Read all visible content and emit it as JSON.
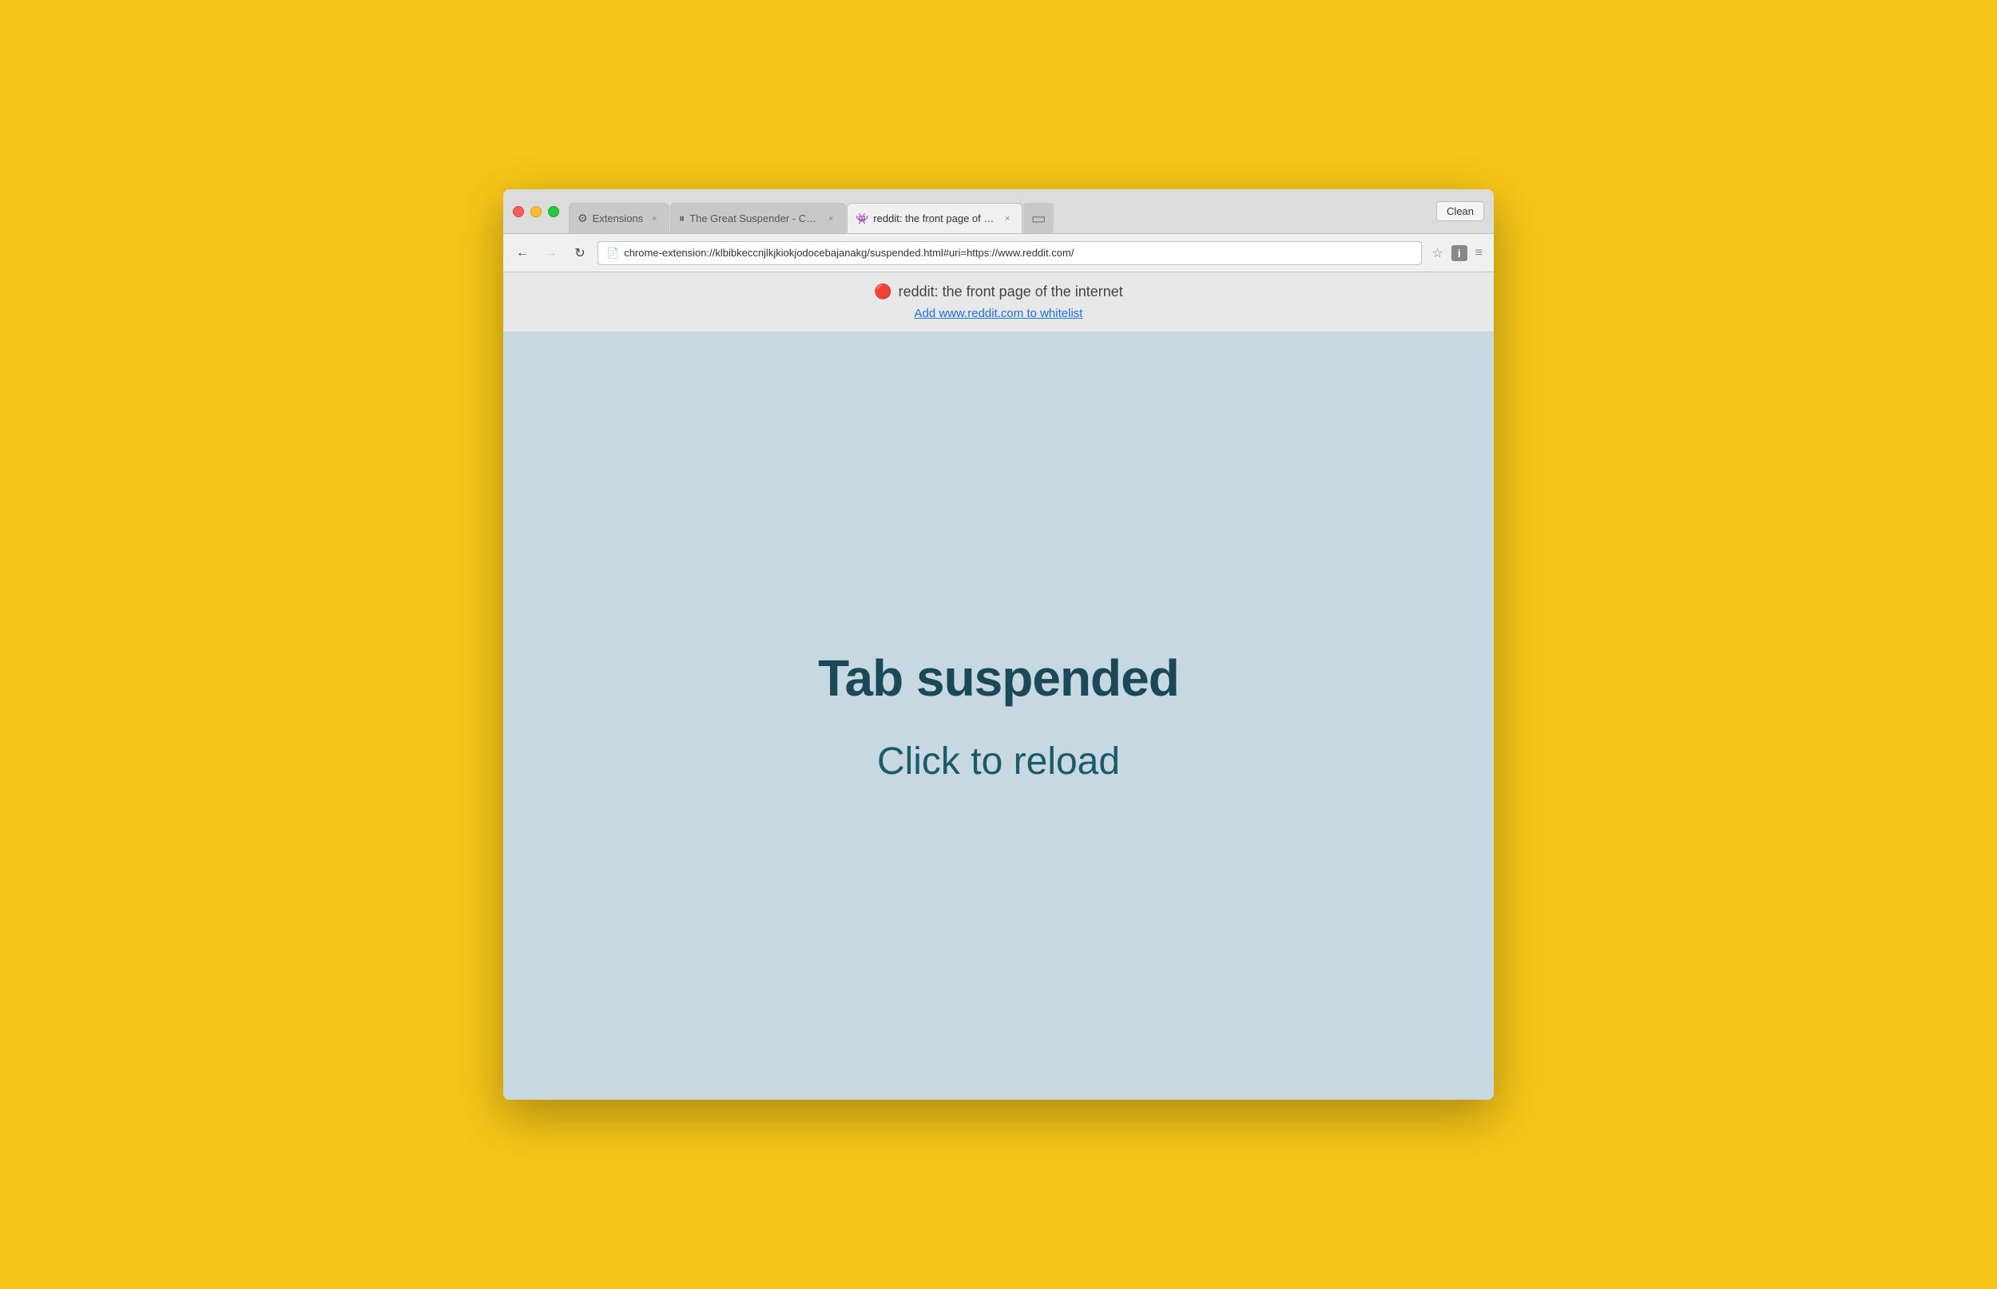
{
  "browser": {
    "background_color": "#F5C518",
    "clean_button_label": "Clean"
  },
  "tabs": [
    {
      "id": "extensions",
      "icon": "⚙",
      "label": "Extensions",
      "active": false,
      "close_label": "×"
    },
    {
      "id": "great-suspender",
      "icon": "⏸",
      "label": "The Great Suspender - Ch…",
      "active": false,
      "close_label": "×"
    },
    {
      "id": "reddit",
      "icon": "🔴",
      "label": "reddit: the front page of th…",
      "active": true,
      "close_label": "×"
    },
    {
      "id": "new-tab",
      "icon": "",
      "label": "",
      "active": false,
      "close_label": ""
    }
  ],
  "navigation": {
    "back_title": "Back",
    "forward_title": "Forward",
    "reload_title": "Reload",
    "address": "chrome-extension://klbibkeccnjlkjkiokjodocebajanakg/suspended.html#uri=https://www.reddit.com/",
    "address_icon": "📄"
  },
  "infobar": {
    "page_title": "reddit: the front page of the internet",
    "reddit_icon": "🔴",
    "whitelist_link": "Add www.reddit.com to whitelist"
  },
  "main": {
    "suspended_label": "Tab suspended",
    "reload_label": "Click to reload",
    "background_color": "#c8d8e0",
    "text_color": "#1a4a5a"
  }
}
